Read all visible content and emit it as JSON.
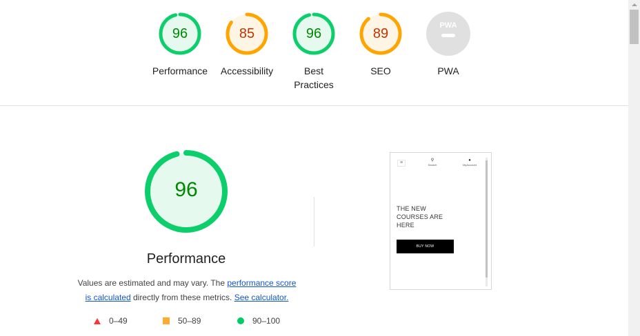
{
  "categories": [
    {
      "id": "performance",
      "label": "Performance",
      "score": "96",
      "value": 96,
      "status": "pass"
    },
    {
      "id": "accessibility",
      "label": "Accessibility",
      "score": "85",
      "value": 85,
      "status": "average"
    },
    {
      "id": "best-practices",
      "label": "Best\nPractices",
      "score": "96",
      "value": 96,
      "status": "pass"
    },
    {
      "id": "seo",
      "label": "SEO",
      "score": "89",
      "value": 89,
      "status": "average"
    },
    {
      "id": "pwa",
      "label": "PWA",
      "badge": "PWA",
      "status": "na"
    }
  ],
  "performance": {
    "score": "96",
    "value": 96,
    "title": "Performance",
    "desc_prefix": "Values are estimated and may vary. The ",
    "link_score": "performance score",
    "link_calc": "is calculated",
    "desc_mid": " directly from these metrics. ",
    "link_calculator": "See calculator."
  },
  "legend": [
    {
      "range": "0–49",
      "shape": "triangle"
    },
    {
      "range": "50–89",
      "shape": "square"
    },
    {
      "range": "90–100",
      "shape": "circle"
    }
  ],
  "thumbnail": {
    "menu_icon": "≡",
    "search_label": "Search",
    "account_label": "MyAccount",
    "hero_text": "THE NEW COURSES ARE HERE",
    "button_label": "BUY NOW"
  },
  "colors": {
    "pass": "#0cce6b",
    "pass_fill": "#e5f9ee",
    "pass_text": "#008800",
    "average": "#ffa400",
    "average_fill": "#fff5e5",
    "average_text": "#c33300",
    "na": "#e0e0e0"
  }
}
